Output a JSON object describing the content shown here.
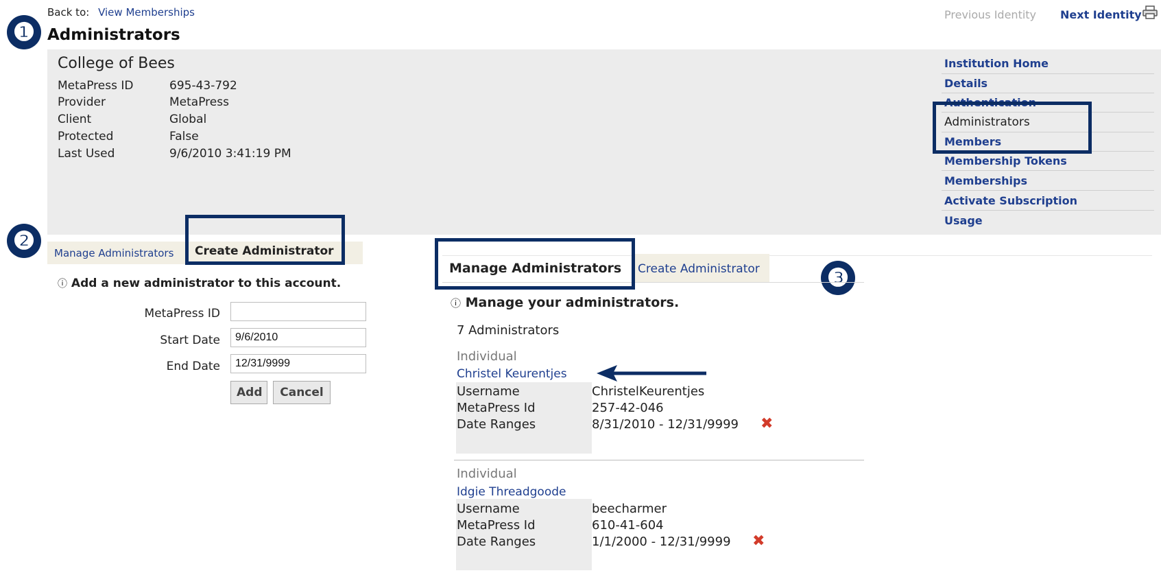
{
  "header": {
    "back_to_label": "Back to:",
    "back_to_link": "View Memberships",
    "page_title": "Administrators",
    "previous_identity": "Previous Identity",
    "next_identity": "Next Identity",
    "print_icon": "printer-icon"
  },
  "institution": {
    "name": "College of Bees",
    "fields": [
      {
        "label": "MetaPress ID",
        "value": "695-43-792"
      },
      {
        "label": "Provider",
        "value": "MetaPress"
      },
      {
        "label": "Client",
        "value": "Global"
      },
      {
        "label": "Protected",
        "value": "False"
      },
      {
        "label": "Last Used",
        "value": "9/6/2010 3:41:19 PM"
      }
    ]
  },
  "nav": {
    "items": [
      {
        "label": "Institution Home"
      },
      {
        "label": "Details"
      },
      {
        "label": "Authentication"
      },
      {
        "label": "Administrators"
      },
      {
        "label": "Members"
      },
      {
        "label": "Membership Tokens"
      },
      {
        "label": "Memberships"
      },
      {
        "label": "Activate Subscription"
      },
      {
        "label": "Usage"
      }
    ]
  },
  "badges": [
    "❶",
    "❷",
    "❸"
  ],
  "create_panel": {
    "tab_manage": "Manage Administrators",
    "tab_create": "Create Administrator",
    "info_text": "Add a new administrator to this account.",
    "metapress_id_label": "MetaPress ID",
    "metapress_id_value": "",
    "start_date_label": "Start Date",
    "start_date_value": "9/6/2010",
    "end_date_label": "End Date",
    "end_date_value": "12/31/9999",
    "add_button": "Add",
    "cancel_button": "Cancel"
  },
  "manage_panel": {
    "tab_manage": "Manage Administrators",
    "tab_create": "Create Administrator",
    "info_text": "Manage your administrators.",
    "count_text": "7 Administrators",
    "administrators": [
      {
        "type": "Individual",
        "name": "Christel Keurentjes",
        "username_label": "Username",
        "username": "ChristelKeurentjes",
        "metapress_id_label": "MetaPress Id",
        "metapress_id": "257-42-046",
        "date_ranges_label": "Date Ranges",
        "date_range": "8/31/2010 - 12/31/9999"
      },
      {
        "type": "Individual",
        "name": "Idgie Threadgoode",
        "username_label": "Username",
        "username": "beecharmer",
        "metapress_id_label": "MetaPress Id",
        "metapress_id": "610-41-604",
        "date_ranges_label": "Date Ranges",
        "date_range": "1/1/2000 - 12/31/9999"
      }
    ]
  },
  "colors": {
    "link": "#1f3f8f",
    "badge": "#0c2d64",
    "panel_bg": "#ececec",
    "delete": "#d23b2a"
  }
}
